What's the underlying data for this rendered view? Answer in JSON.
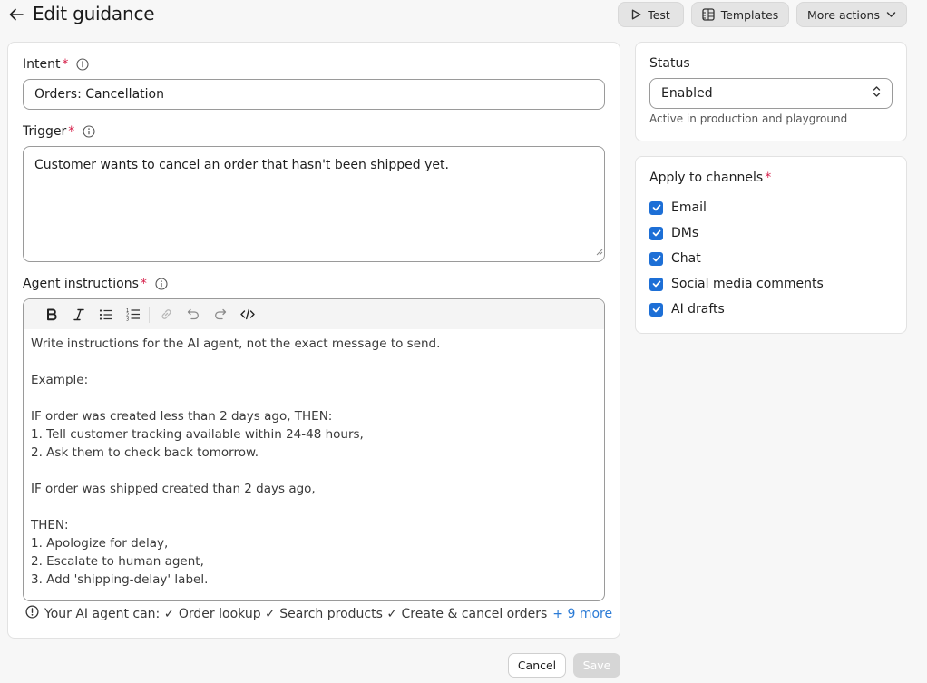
{
  "header": {
    "title": "Edit guidance",
    "test_label": "Test",
    "templates_label": "Templates",
    "more_actions_label": "More actions"
  },
  "form": {
    "intent": {
      "label": "Intent",
      "required_mark": "*",
      "value": "Orders: Cancellation"
    },
    "trigger": {
      "label": "Trigger",
      "required_mark": "*",
      "value": "Customer wants to cancel an order that hasn't been shipped yet."
    },
    "instructions": {
      "label": "Agent instructions",
      "required_mark": "*",
      "lines": [
        "Write instructions for the AI agent, not the exact message to send.",
        "",
        "Example:",
        "",
        "IF order was created less than 2 days ago, THEN:",
        "1. Tell customer tracking available within 24-48 hours,",
        "2. Ask them to check back tomorrow.",
        "",
        "IF order was shipped created than 2 days ago,",
        "",
        "THEN:",
        "1. Apologize for delay,",
        "2. Escalate to human agent,",
        "3. Add 'shipping-delay' label."
      ]
    },
    "capabilities_text": "Your AI agent can: ✓ Order lookup ✓ Search products ✓ Create & cancel orders",
    "capabilities_more": "+ 9 more",
    "cancel_label": "Cancel",
    "save_label": "Save"
  },
  "status": {
    "label": "Status",
    "value": "Enabled",
    "hint": "Active in production and playground"
  },
  "channels": {
    "label": "Apply to channels",
    "required_mark": "*",
    "items": [
      {
        "label": "Email",
        "checked": true
      },
      {
        "label": "DMs",
        "checked": true
      },
      {
        "label": "Chat",
        "checked": true
      },
      {
        "label": "Social media comments",
        "checked": true
      },
      {
        "label": "AI drafts",
        "checked": true
      }
    ]
  },
  "colors": {
    "accent": "#1d6fd6",
    "required": "#d6214b",
    "link": "#2b7bd6",
    "save_disabled": "#d6d6d6"
  }
}
